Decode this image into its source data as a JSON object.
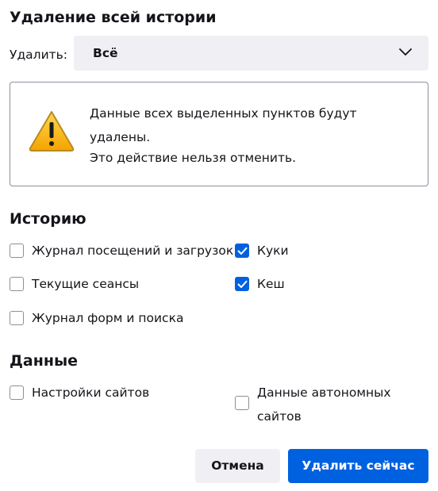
{
  "dialog": {
    "title": "Удаление всей истории"
  },
  "period": {
    "label": "Удалить:",
    "selected": "Всё"
  },
  "warning": {
    "line1": "Данные всех выделенных пунктов будут удалены.",
    "line2": "Это действие нельзя отменить."
  },
  "history": {
    "heading": "Историю",
    "items": [
      {
        "label": "Журнал посещений и загрузок",
        "checked": false
      },
      {
        "label": "Куки",
        "checked": true
      },
      {
        "label": "Текущие сеансы",
        "checked": false
      },
      {
        "label": "Кеш",
        "checked": true
      },
      {
        "label": "Журнал форм и поиска",
        "checked": false
      }
    ]
  },
  "data_section": {
    "heading": "Данные",
    "items": [
      {
        "label": "Настройки сайтов",
        "checked": false
      },
      {
        "label": "Данные автономных сайтов",
        "checked": false
      }
    ]
  },
  "buttons": {
    "cancel": "Отмена",
    "clear": "Удалить сейчас"
  },
  "colors": {
    "accent": "#0061e0",
    "neutral_button": "#f0f0f4",
    "warning_yellow": "#ffbf00"
  },
  "icons": {
    "dropdown": "chevron-down-icon",
    "warning": "warning-triangle-icon",
    "check": "checkmark-icon"
  }
}
